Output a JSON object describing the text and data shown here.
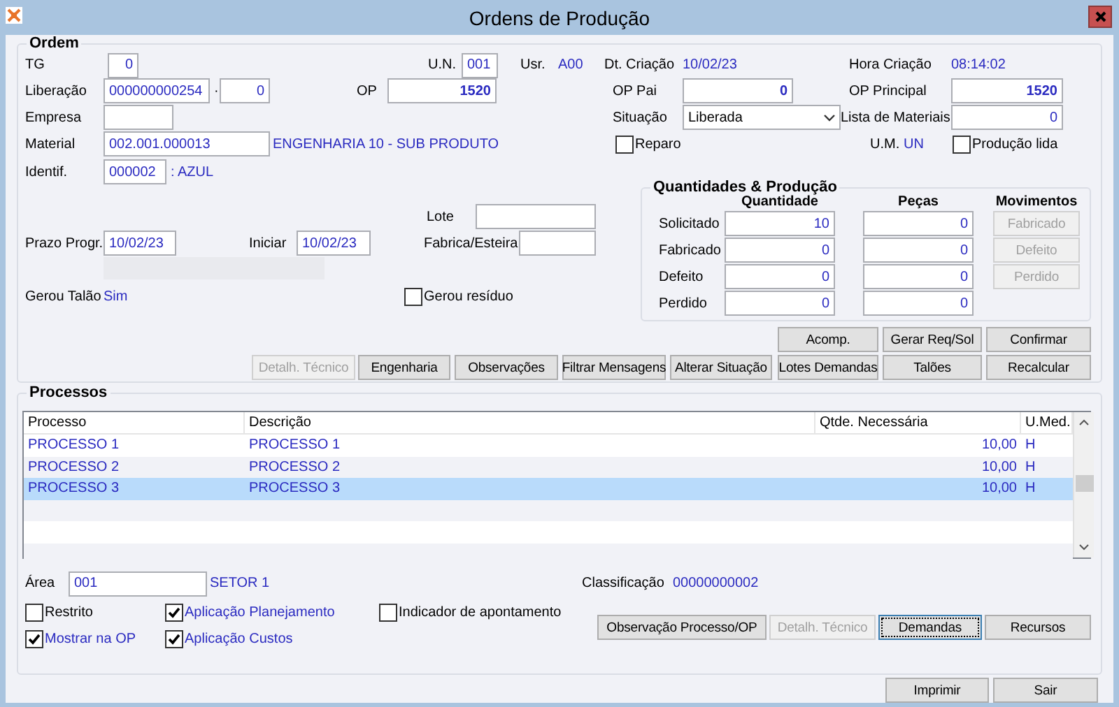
{
  "window": {
    "title": "Ordens de Produção"
  },
  "ordem": {
    "title": "Ordem",
    "tg": {
      "label": "TG",
      "value": "0"
    },
    "un": {
      "label": "U.N.",
      "value": "001"
    },
    "usr": {
      "label": "Usr.",
      "value": "A00"
    },
    "dt_criacao": {
      "label": "Dt. Criação",
      "value": "10/02/23"
    },
    "hora_criacao": {
      "label": "Hora Criação",
      "value": "08:14:02"
    },
    "liberacao": {
      "label": "Liberação",
      "value": "000000000254",
      "separator": "·",
      "sequence": "0"
    },
    "op": {
      "label": "OP",
      "value": "1520"
    },
    "op_pai": {
      "label": "OP Pai",
      "value": "0"
    },
    "op_principal": {
      "label": "OP Principal",
      "value": "1520"
    },
    "empresa": {
      "label": "Empresa"
    },
    "situacao": {
      "label": "Situação",
      "value": "Liberada"
    },
    "lista_materiais": {
      "label": "Lista de Materiais",
      "value": "0"
    },
    "material": {
      "label": "Material",
      "value": "002.001.000013",
      "description": "ENGENHARIA 10 - SUB PRODUTO"
    },
    "reparo": {
      "label": "Reparo",
      "checked": false
    },
    "um": {
      "label": "U.M.",
      "value": "UN"
    },
    "producao_lida": {
      "label": "Produção lida",
      "checked": false
    },
    "identif": {
      "label": "Identif.",
      "value": "000002",
      "description": ": AZUL"
    },
    "lote": {
      "label": "Lote"
    },
    "prazo_progr": {
      "label": "Prazo Progr.",
      "value": "10/02/23"
    },
    "iniciar": {
      "label": "Iniciar",
      "value": "10/02/23"
    },
    "fabrica_esteira": {
      "label": "Fabrica/Esteira"
    },
    "gerou_talao": {
      "label": "Gerou Talão",
      "value": "Sim"
    },
    "gerou_residuo": {
      "label": "Gerou resíduo",
      "checked": false
    },
    "quantidades": {
      "title": "Quantidades & Produção",
      "columns": [
        "Quantidade",
        "Peças"
      ],
      "movimentos_title": "Movimentos",
      "rows": [
        {
          "label": "Solicitado",
          "quantidade": "10",
          "pecas": "0"
        },
        {
          "label": "Fabricado",
          "quantidade": "0",
          "pecas": "0"
        },
        {
          "label": "Defeito",
          "quantidade": "0",
          "pecas": "0"
        },
        {
          "label": "Perdido",
          "quantidade": "0",
          "pecas": "0"
        }
      ],
      "movimentos": [
        {
          "label": "Fabricado",
          "disabled": true
        },
        {
          "label": "Defeito",
          "disabled": true
        },
        {
          "label": "Perdido",
          "disabled": true
        }
      ]
    },
    "buttons_row_1": [
      {
        "label": "Acomp.",
        "disabled": false
      },
      {
        "label": "Gerar Req/Sol",
        "disabled": false
      },
      {
        "label": "Confirmar",
        "disabled": false
      }
    ],
    "buttons_row_2": [
      {
        "label": "Detalh. Técnico",
        "disabled": true
      },
      {
        "label": "Engenharia",
        "disabled": false
      },
      {
        "label": "Observações",
        "disabled": false
      },
      {
        "label": "Filtrar Mensagens",
        "disabled": false
      },
      {
        "label": "Alterar Situação",
        "disabled": false
      },
      {
        "label": "Lotes Demandas",
        "disabled": false
      },
      {
        "label": "Talões",
        "disabled": false
      },
      {
        "label": "Recalcular",
        "disabled": false
      }
    ]
  },
  "processos": {
    "title": "Processos",
    "table": {
      "columns": [
        "Processo",
        "Descrição",
        "Qtde. Necessária",
        "U.Med."
      ],
      "rows": [
        {
          "cells": [
            "PROCESSO 1",
            "PROCESSO 1",
            "10,00",
            "H"
          ],
          "selected": false
        },
        {
          "cells": [
            "PROCESSO 2",
            "PROCESSO 2",
            "10,00",
            "H"
          ],
          "selected": false
        },
        {
          "cells": [
            "PROCESSO 3",
            "PROCESSO 3",
            "10,00",
            "H"
          ],
          "selected": true
        }
      ]
    },
    "area": {
      "label": "Área",
      "value": "001",
      "description": "SETOR 1"
    },
    "classificacao": {
      "label": "Classificação",
      "value": "00000000002"
    },
    "checkboxes": [
      {
        "label": "Restrito",
        "checked": false
      },
      {
        "label": "Aplicação Planejamento",
        "checked": true
      },
      {
        "label": "Indicador de apontamento",
        "checked": false
      },
      {
        "label": "Mostrar na OP",
        "checked": true
      },
      {
        "label": "Aplicação Custos",
        "checked": true
      }
    ],
    "buttons": [
      {
        "label": "Observação Processo/OP",
        "disabled": false,
        "focused": false
      },
      {
        "label": "Detalh. Técnico",
        "disabled": true,
        "focused": false
      },
      {
        "label": "Demandas",
        "disabled": false,
        "focused": true
      },
      {
        "label": "Recursos",
        "disabled": false,
        "focused": false
      }
    ]
  },
  "footer_buttons": [
    {
      "label": "Imprimir",
      "disabled": false
    },
    {
      "label": "Sair",
      "disabled": false
    }
  ]
}
